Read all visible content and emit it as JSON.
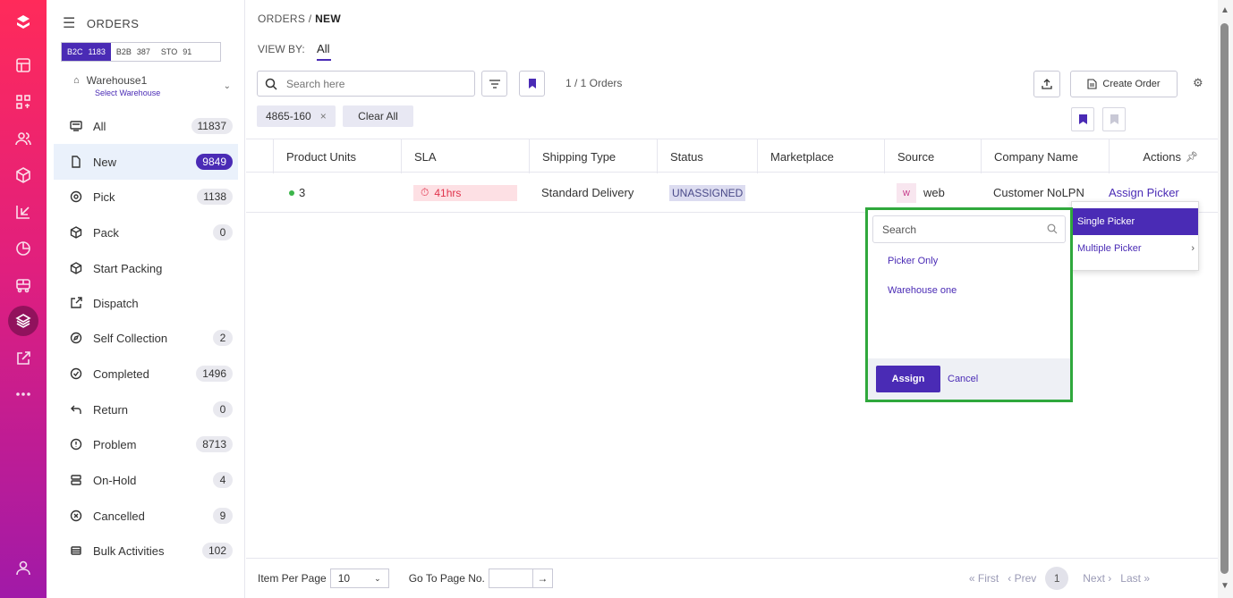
{
  "sidebar": {
    "title": "ORDERS",
    "channels": [
      {
        "label": "B2C",
        "count": "1183"
      },
      {
        "label": "B2B",
        "count": "387"
      },
      {
        "label": "STO",
        "count": "91"
      }
    ],
    "warehouse": {
      "name": "Warehouse1",
      "sub": "Select Warehouse"
    },
    "items": [
      {
        "label": "All",
        "count": "11837"
      },
      {
        "label": "New",
        "count": "9849"
      },
      {
        "label": "Pick",
        "count": "1138"
      },
      {
        "label": "Pack",
        "count": "0"
      },
      {
        "label": "Start Packing",
        "count": ""
      },
      {
        "label": "Dispatch",
        "count": ""
      },
      {
        "label": "Self Collection",
        "count": "2"
      },
      {
        "label": "Completed",
        "count": "1496"
      },
      {
        "label": "Return",
        "count": "0"
      },
      {
        "label": "Problem",
        "count": "8713"
      },
      {
        "label": "On-Hold",
        "count": "4"
      },
      {
        "label": "Cancelled",
        "count": "9"
      },
      {
        "label": "Bulk Activities",
        "count": "102"
      }
    ]
  },
  "header": {
    "breadcrumb_root": "ORDERS",
    "breadcrumb_sep": "/",
    "breadcrumb_current": "NEW",
    "view_by_label": "VIEW BY:",
    "view_by_value": "All",
    "search_placeholder": "Search here",
    "orders_count": "1 / 1 Orders",
    "create_order": "Create Order",
    "filter_tag": "4865-160",
    "clear_all": "Clear All"
  },
  "table": {
    "columns": [
      "Product Units",
      "SLA",
      "Shipping Type",
      "Status",
      "Marketplace",
      "Source",
      "Company Name",
      "Actions"
    ],
    "row": {
      "units": "3",
      "sla": "41hrs",
      "shipping": "Standard Delivery",
      "status": "UNASSIGNED",
      "marketplace": "",
      "source_badge": "w",
      "source": "web",
      "company": "Customer NoLPN",
      "action": "Assign Picker"
    }
  },
  "footer": {
    "per_page_label": "Item Per Page",
    "per_page_value": "10",
    "goto_label": "Go To Page No.",
    "first": "First",
    "prev": "Prev",
    "current_page": "1",
    "next": "Next",
    "last": "Last"
  },
  "picker_menu": {
    "items": [
      "Single Picker",
      "Multiple Picker"
    ]
  },
  "picker_popup": {
    "search_placeholder": "Search",
    "options": [
      "Picker Only",
      "Warehouse one"
    ],
    "assign": "Assign",
    "cancel": "Cancel"
  },
  "colors": {
    "brand": "#4a2bb5",
    "highlight": "#2fa83c",
    "rail_top": "#ff2a5a",
    "rail_bottom": "#a11aa8"
  }
}
